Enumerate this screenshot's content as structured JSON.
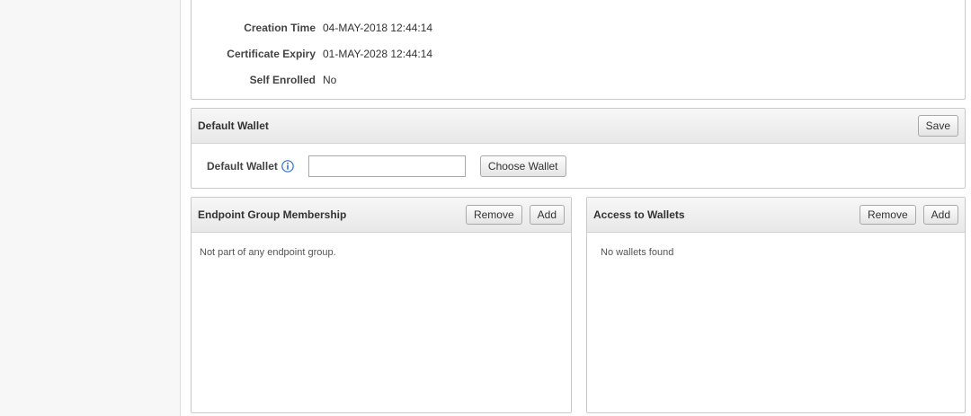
{
  "details": {
    "rows": [
      {
        "label": "Creation Time",
        "value": "04-MAY-2018 12:44:14"
      },
      {
        "label": "Certificate Expiry",
        "value": "01-MAY-2028 12:44:14"
      },
      {
        "label": "Self Enrolled",
        "value": "No"
      }
    ]
  },
  "default_wallet": {
    "title": "Default Wallet",
    "save_label": "Save",
    "field_label": "Default Wallet",
    "input_value": "",
    "choose_label": "Choose Wallet",
    "info_icon": "info-icon"
  },
  "endpoint_group": {
    "title": "Endpoint Group Membership",
    "remove_label": "Remove",
    "add_label": "Add",
    "empty_text": "Not part of any endpoint group."
  },
  "access_wallets": {
    "title": "Access to Wallets",
    "remove_label": "Remove",
    "add_label": "Add",
    "empty_text": "No wallets found"
  },
  "colors": {
    "info_icon": "#2e6fd8",
    "panel_border": "#c9c9c9"
  }
}
